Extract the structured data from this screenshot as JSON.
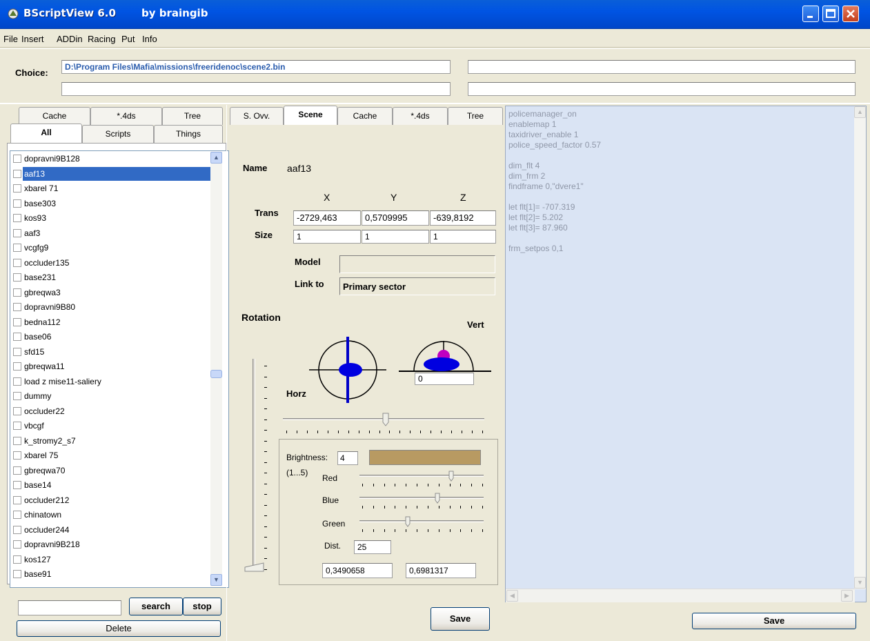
{
  "window": {
    "title": "BScriptView 6.0",
    "author": "by braingib"
  },
  "menu": [
    "File",
    "Insert",
    "ADDin",
    "Racing",
    "Put",
    "Info"
  ],
  "choice": {
    "label": "Choice:",
    "path": "D:\\Program Files\\Mafia\\missions\\freeridenoc\\scene2.bin",
    "field2": "",
    "field3": "",
    "field4": ""
  },
  "left_panel": {
    "tabs_top": [
      "Cache",
      "*.4ds",
      "Tree"
    ],
    "tabs_bottom": [
      "All",
      "Scripts",
      "Things"
    ],
    "active_tab": "All",
    "items": [
      "dopravni9B128",
      "aaf13",
      "xbarel 71",
      "base303",
      "kos93",
      "aaf3",
      "vcgfg9",
      "occluder135",
      "base231",
      "gbreqwa3",
      "dopravni9B80",
      "bedna112",
      "base06",
      "sfd15",
      "gbreqwa11",
      "load z mise11-saliery",
      "dummy",
      "occluder22",
      "vbcgf",
      "k_stromy2_s7",
      "xbarel 75",
      "gbreqwa70",
      "base14",
      "occluder212",
      "chinatown",
      "occluder244",
      "dopravni9B218",
      "kos127",
      "base91"
    ],
    "selected_item": "aaf13",
    "search_value": "",
    "search_label": "search",
    "stop_label": "stop",
    "delete_label": "Delete"
  },
  "middle_panel": {
    "tabs": [
      "S. Ovv.",
      "Scene",
      "Cache",
      "*.4ds",
      "Tree"
    ],
    "active_tab": "Scene",
    "name_label": "Name",
    "name_value": "aaf13",
    "axis_labels": [
      "X",
      "Y",
      "Z"
    ],
    "trans_label": "Trans",
    "trans": [
      "-2729,463",
      "0,5709995",
      "-639,8192"
    ],
    "size_label": "Size",
    "size": [
      "1",
      "1",
      "1"
    ],
    "model_label": "Model",
    "model_value": "",
    "link_label": "Link to",
    "link_value": "Primary sector",
    "rotation_label": "Rotation",
    "horz_label": "Horz",
    "vert_label": "Vert",
    "vert_value": "0",
    "brightness_label": "Brightness:",
    "brightness_value": "4",
    "brightness_range": "(1...5)",
    "brightness_color": "#b89a62",
    "red_label": "Red",
    "blue_label": "Blue",
    "green_label": "Green",
    "dist_label": "Dist.",
    "dist_value": "25",
    "rot_a": "0,3490658",
    "rot_b": "0,6981317",
    "save_label": "Save"
  },
  "script_panel": {
    "lines": [
      "policemanager_on",
      "enablemap 1",
      "taxidriver_enable 1",
      "police_speed_factor 0.57",
      "",
      "dim_flt 4",
      "dim_frm 2",
      "findframe 0,\"dvere1\"",
      "",
      "let flt[1]= -707.319",
      "let flt[2]= 5.202",
      "let flt[3]= 87.960",
      "",
      "frm_setpos 0,1"
    ],
    "save_label": "Save"
  }
}
